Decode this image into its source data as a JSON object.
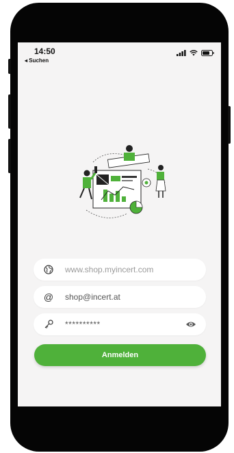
{
  "status_bar": {
    "time": "14:50",
    "back_label": "◂ Suchen"
  },
  "illustration": {
    "name": "team-dashboard-illustration",
    "accent_color": "#4fb13a"
  },
  "form": {
    "shop_url": {
      "icon": "globe-icon",
      "placeholder": "www.shop.myincert.com",
      "value": ""
    },
    "email": {
      "icon": "at-icon",
      "value": "shop@incert.at"
    },
    "password": {
      "icon": "key-icon",
      "value": "**********",
      "toggle_icon": "eye-icon"
    }
  },
  "login_button": {
    "label": "Anmelden",
    "color": "#4fb13a"
  }
}
